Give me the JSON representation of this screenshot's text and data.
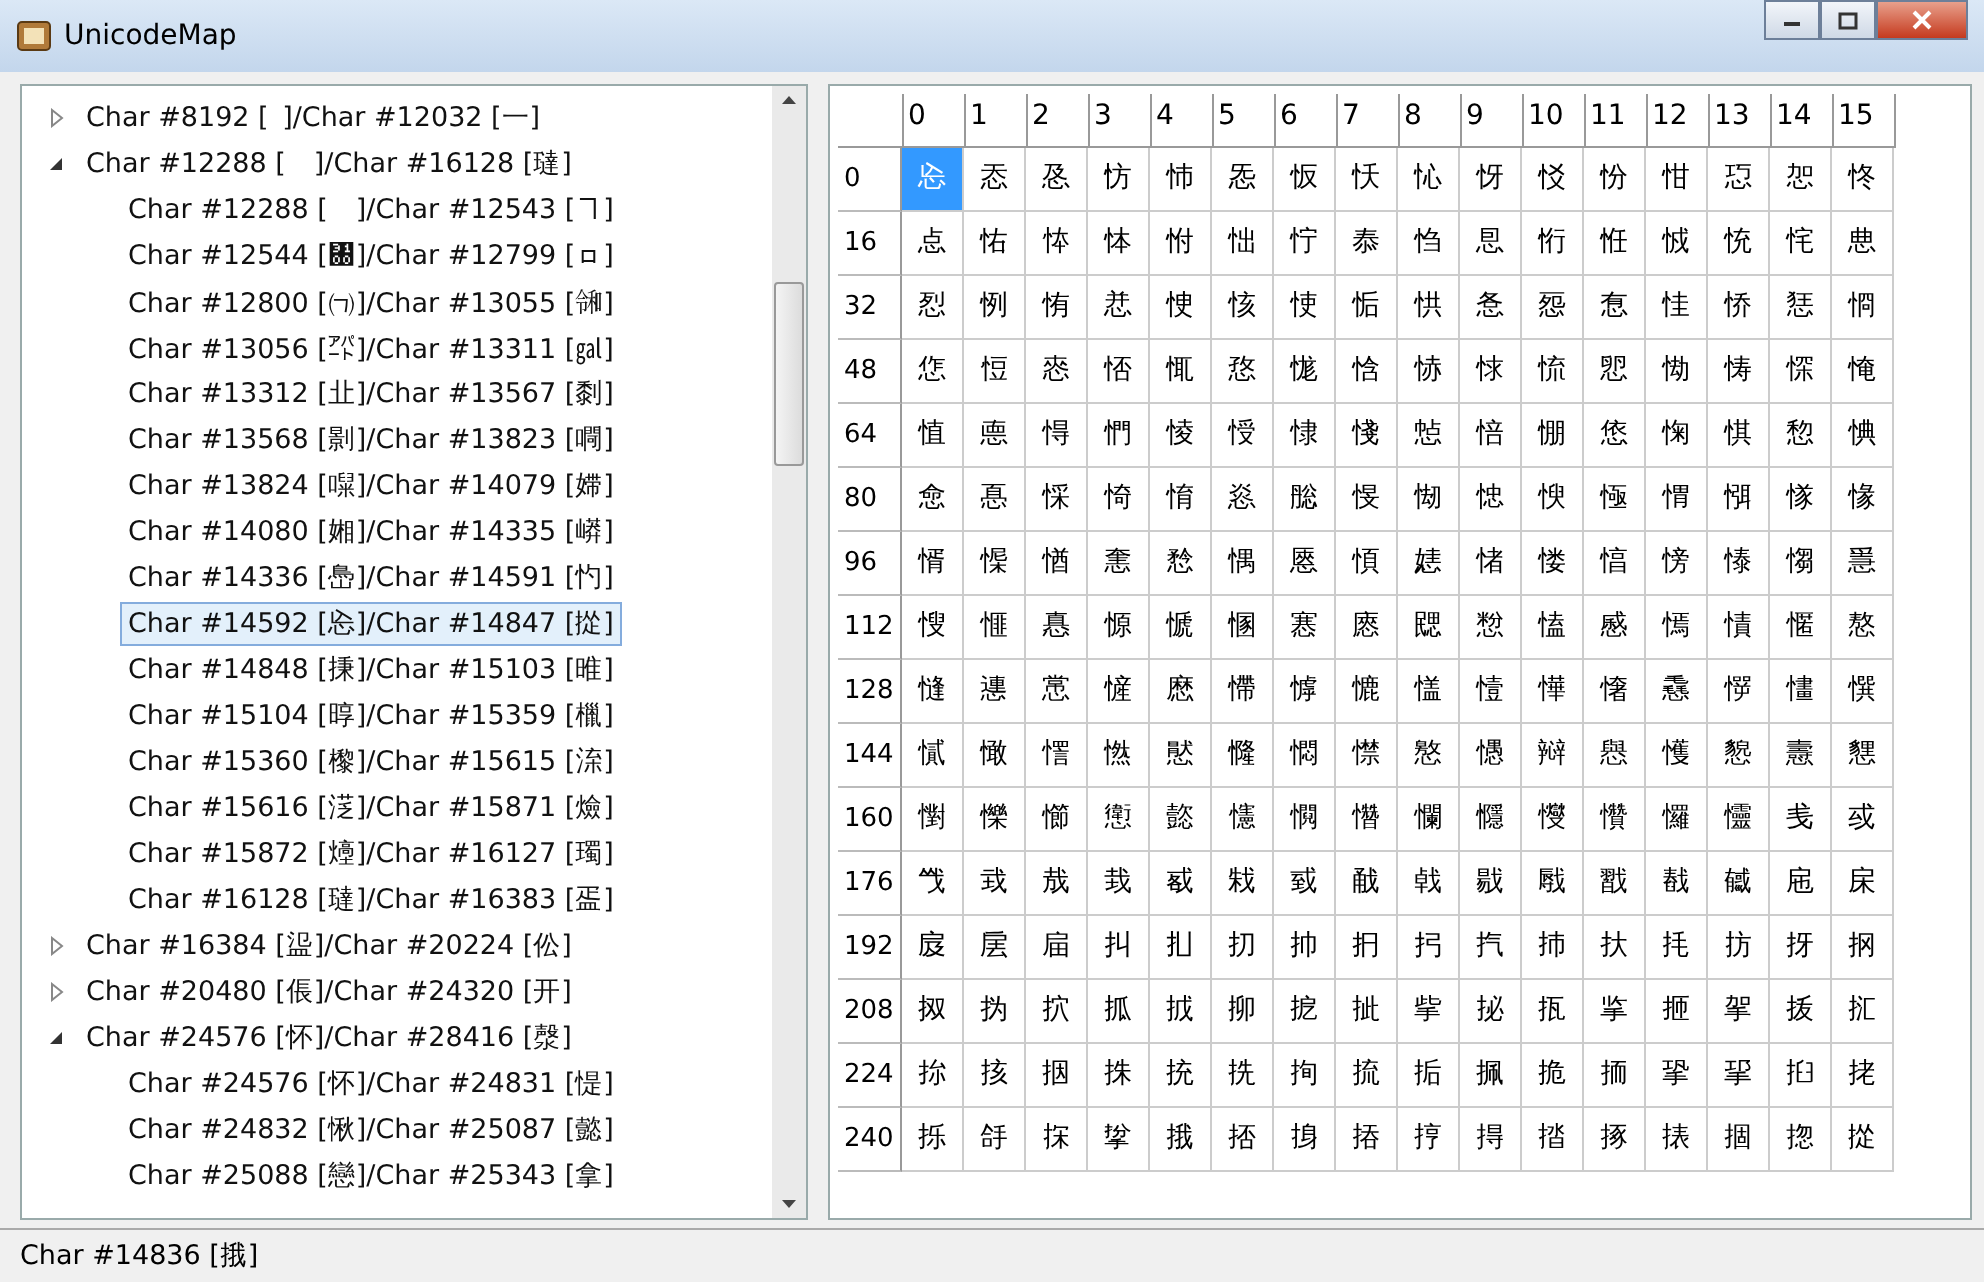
{
  "window": {
    "title": "UnicodeMap"
  },
  "tree": [
    {
      "label": "Char #8192 [ ]/Char #12032 [⼀]",
      "expanded": false,
      "selected": false
    },
    {
      "label": "Char #12288 [　]/Char #16128 [㼀]",
      "expanded": true,
      "selected": false,
      "children": [
        {
          "label": "Char #12288 [　]/Char #12543 [ヿ]",
          "selected": false
        },
        {
          "label": "Char #12544 [㄀]/Char #12799 [ㇿ]",
          "selected": false
        },
        {
          "label": "Char #12800 [㈀]/Char #13055 [㋿]",
          "selected": false
        },
        {
          "label": "Char #13056 [㌀]/Char #13311 [㏿]",
          "selected": false
        },
        {
          "label": "Char #13312 [㐀]/Char #13567 [㓿]",
          "selected": false
        },
        {
          "label": "Char #13568 [㔀]/Char #13823 [㗿]",
          "selected": false
        },
        {
          "label": "Char #13824 [㘀]/Char #14079 [㛿]",
          "selected": false
        },
        {
          "label": "Char #14080 [㜀]/Char #14335 [㟿]",
          "selected": false
        },
        {
          "label": "Char #14336 [㠀]/Char #14591 [㣿]",
          "selected": false
        },
        {
          "label": "Char #14592 [㤀]/Char #14847 [㧿]",
          "selected": true
        },
        {
          "label": "Char #14848 [㨀]/Char #15103 [㫿]",
          "selected": false
        },
        {
          "label": "Char #15104 [㬀]/Char #15359 [㯿]",
          "selected": false
        },
        {
          "label": "Char #15360 [㰀]/Char #15615 [㳿]",
          "selected": false
        },
        {
          "label": "Char #15616 [㴀]/Char #15871 [㷿]",
          "selected": false
        },
        {
          "label": "Char #15872 [㸀]/Char #16127 [㻿]",
          "selected": false
        },
        {
          "label": "Char #16128 [㼀]/Char #16383 [㿿]",
          "selected": false
        }
      ]
    },
    {
      "label": "Char #16384 [䀀]/Char #20224 [伀]",
      "expanded": false,
      "selected": false
    },
    {
      "label": "Char #20480 [倀]/Char #24320 [开]",
      "expanded": false,
      "selected": false
    },
    {
      "label": "Char #24576 [怀]/Char #28416 [漀]",
      "expanded": true,
      "selected": false,
      "children": [
        {
          "label": "Char #24576 [怀]/Char #24831 [惿]",
          "selected": false
        },
        {
          "label": "Char #24832 [愀]/Char #25087 [懿]",
          "selected": false
        },
        {
          "label": "Char #25088 [戀]/Char #25343 [拿]",
          "selected": false
        }
      ]
    }
  ],
  "grid": {
    "columns": [
      "0",
      "1",
      "2",
      "3",
      "4",
      "5",
      "6",
      "7",
      "8",
      "9",
      "10",
      "11",
      "12",
      "13",
      "14",
      "15"
    ],
    "rows": [
      {
        "label": "0",
        "cells": [
          {
            "char": "㤀",
            "selected": true
          },
          {
            "char": "㤁",
            "selected": false
          },
          {
            "char": "㤂",
            "selected": false
          },
          {
            "char": "㤃",
            "selected": false
          },
          {
            "char": "㤄",
            "selected": false
          },
          {
            "char": "㤅",
            "selected": false
          },
          {
            "char": "㤆",
            "selected": false
          },
          {
            "char": "㤇",
            "selected": false
          },
          {
            "char": "㤈",
            "selected": false
          },
          {
            "char": "㤉",
            "selected": false
          },
          {
            "char": "㤊",
            "selected": false
          },
          {
            "char": "㤋",
            "selected": false
          },
          {
            "char": "㤌",
            "selected": false
          },
          {
            "char": "㤍",
            "selected": false
          },
          {
            "char": "㤎",
            "selected": false
          },
          {
            "char": "㤏",
            "selected": false
          }
        ]
      },
      {
        "label": "16",
        "cells": [
          {
            "char": "㤐",
            "selected": false
          },
          {
            "char": "㤑",
            "selected": false
          },
          {
            "char": "㤒",
            "selected": false
          },
          {
            "char": "㤓",
            "selected": false
          },
          {
            "char": "㤔",
            "selected": false
          },
          {
            "char": "㤕",
            "selected": false
          },
          {
            "char": "㤖",
            "selected": false
          },
          {
            "char": "㤗",
            "selected": false
          },
          {
            "char": "㤘",
            "selected": false
          },
          {
            "char": "㤙",
            "selected": false
          },
          {
            "char": "㤚",
            "selected": false
          },
          {
            "char": "㤛",
            "selected": false
          },
          {
            "char": "㤜",
            "selected": false
          },
          {
            "char": "㤝",
            "selected": false
          },
          {
            "char": "㤞",
            "selected": false
          },
          {
            "char": "㤟",
            "selected": false
          }
        ]
      },
      {
        "label": "32",
        "cells": [
          {
            "char": "㤠",
            "selected": false
          },
          {
            "char": "㤡",
            "selected": false
          },
          {
            "char": "㤢",
            "selected": false
          },
          {
            "char": "㤣",
            "selected": false
          },
          {
            "char": "㤤",
            "selected": false
          },
          {
            "char": "㤥",
            "selected": false
          },
          {
            "char": "㤦",
            "selected": false
          },
          {
            "char": "㤧",
            "selected": false
          },
          {
            "char": "㤨",
            "selected": false
          },
          {
            "char": "㤩",
            "selected": false
          },
          {
            "char": "㤪",
            "selected": false
          },
          {
            "char": "㤫",
            "selected": false
          },
          {
            "char": "㤬",
            "selected": false
          },
          {
            "char": "㤭",
            "selected": false
          },
          {
            "char": "㤮",
            "selected": false
          },
          {
            "char": "㤯",
            "selected": false
          }
        ]
      },
      {
        "label": "48",
        "cells": [
          {
            "char": "㤰",
            "selected": false
          },
          {
            "char": "㤱",
            "selected": false
          },
          {
            "char": "㤲",
            "selected": false
          },
          {
            "char": "㤳",
            "selected": false
          },
          {
            "char": "㤴",
            "selected": false
          },
          {
            "char": "㤵",
            "selected": false
          },
          {
            "char": "㤶",
            "selected": false
          },
          {
            "char": "㤷",
            "selected": false
          },
          {
            "char": "㤸",
            "selected": false
          },
          {
            "char": "㤹",
            "selected": false
          },
          {
            "char": "㤺",
            "selected": false
          },
          {
            "char": "㤻",
            "selected": false
          },
          {
            "char": "㤼",
            "selected": false
          },
          {
            "char": "㤽",
            "selected": false
          },
          {
            "char": "㤾",
            "selected": false
          },
          {
            "char": "㤿",
            "selected": false
          }
        ]
      },
      {
        "label": "64",
        "cells": [
          {
            "char": "㥀",
            "selected": false
          },
          {
            "char": "㥁",
            "selected": false
          },
          {
            "char": "㥂",
            "selected": false
          },
          {
            "char": "㥃",
            "selected": false
          },
          {
            "char": "㥄",
            "selected": false
          },
          {
            "char": "㥅",
            "selected": false
          },
          {
            "char": "㥆",
            "selected": false
          },
          {
            "char": "㥇",
            "selected": false
          },
          {
            "char": "㥈",
            "selected": false
          },
          {
            "char": "㥉",
            "selected": false
          },
          {
            "char": "㥊",
            "selected": false
          },
          {
            "char": "㥋",
            "selected": false
          },
          {
            "char": "㥌",
            "selected": false
          },
          {
            "char": "㥍",
            "selected": false
          },
          {
            "char": "㥎",
            "selected": false
          },
          {
            "char": "㥏",
            "selected": false
          }
        ]
      },
      {
        "label": "80",
        "cells": [
          {
            "char": "㥐",
            "selected": false
          },
          {
            "char": "㥑",
            "selected": false
          },
          {
            "char": "㥒",
            "selected": false
          },
          {
            "char": "㥓",
            "selected": false
          },
          {
            "char": "㥔",
            "selected": false
          },
          {
            "char": "㥕",
            "selected": false
          },
          {
            "char": "㥖",
            "selected": false
          },
          {
            "char": "㥗",
            "selected": false
          },
          {
            "char": "㥘",
            "selected": false
          },
          {
            "char": "㥙",
            "selected": false
          },
          {
            "char": "㥚",
            "selected": false
          },
          {
            "char": "㥛",
            "selected": false
          },
          {
            "char": "㥜",
            "selected": false
          },
          {
            "char": "㥝",
            "selected": false
          },
          {
            "char": "㥞",
            "selected": false
          },
          {
            "char": "㥟",
            "selected": false
          }
        ]
      },
      {
        "label": "96",
        "cells": [
          {
            "char": "㥠",
            "selected": false
          },
          {
            "char": "㥡",
            "selected": false
          },
          {
            "char": "㥢",
            "selected": false
          },
          {
            "char": "㥣",
            "selected": false
          },
          {
            "char": "㥤",
            "selected": false
          },
          {
            "char": "㥥",
            "selected": false
          },
          {
            "char": "㥦",
            "selected": false
          },
          {
            "char": "㥧",
            "selected": false
          },
          {
            "char": "㥨",
            "selected": false
          },
          {
            "char": "㥩",
            "selected": false
          },
          {
            "char": "㥪",
            "selected": false
          },
          {
            "char": "㥫",
            "selected": false
          },
          {
            "char": "㥬",
            "selected": false
          },
          {
            "char": "㥭",
            "selected": false
          },
          {
            "char": "㥮",
            "selected": false
          },
          {
            "char": "㥯",
            "selected": false
          }
        ]
      },
      {
        "label": "112",
        "cells": [
          {
            "char": "㥰",
            "selected": false
          },
          {
            "char": "㥱",
            "selected": false
          },
          {
            "char": "㥲",
            "selected": false
          },
          {
            "char": "㥳",
            "selected": false
          },
          {
            "char": "㥴",
            "selected": false
          },
          {
            "char": "㥵",
            "selected": false
          },
          {
            "char": "㥶",
            "selected": false
          },
          {
            "char": "㥷",
            "selected": false
          },
          {
            "char": "㥸",
            "selected": false
          },
          {
            "char": "㥹",
            "selected": false
          },
          {
            "char": "㥺",
            "selected": false
          },
          {
            "char": "㥻",
            "selected": false
          },
          {
            "char": "㥼",
            "selected": false
          },
          {
            "char": "㥽",
            "selected": false
          },
          {
            "char": "㥾",
            "selected": false
          },
          {
            "char": "㥿",
            "selected": false
          }
        ]
      },
      {
        "label": "128",
        "cells": [
          {
            "char": "㦀",
            "selected": false
          },
          {
            "char": "㦁",
            "selected": false
          },
          {
            "char": "㦂",
            "selected": false
          },
          {
            "char": "㦃",
            "selected": false
          },
          {
            "char": "㦄",
            "selected": false
          },
          {
            "char": "㦅",
            "selected": false
          },
          {
            "char": "㦆",
            "selected": false
          },
          {
            "char": "㦇",
            "selected": false
          },
          {
            "char": "㦈",
            "selected": false
          },
          {
            "char": "㦉",
            "selected": false
          },
          {
            "char": "㦊",
            "selected": false
          },
          {
            "char": "㦋",
            "selected": false
          },
          {
            "char": "㦌",
            "selected": false
          },
          {
            "char": "㦍",
            "selected": false
          },
          {
            "char": "㦎",
            "selected": false
          },
          {
            "char": "㦏",
            "selected": false
          }
        ]
      },
      {
        "label": "144",
        "cells": [
          {
            "char": "㦐",
            "selected": false
          },
          {
            "char": "㦑",
            "selected": false
          },
          {
            "char": "㦒",
            "selected": false
          },
          {
            "char": "㦓",
            "selected": false
          },
          {
            "char": "㦔",
            "selected": false
          },
          {
            "char": "㦕",
            "selected": false
          },
          {
            "char": "㦖",
            "selected": false
          },
          {
            "char": "㦗",
            "selected": false
          },
          {
            "char": "㦘",
            "selected": false
          },
          {
            "char": "㦙",
            "selected": false
          },
          {
            "char": "㦚",
            "selected": false
          },
          {
            "char": "㦛",
            "selected": false
          },
          {
            "char": "㦜",
            "selected": false
          },
          {
            "char": "㦝",
            "selected": false
          },
          {
            "char": "㦞",
            "selected": false
          },
          {
            "char": "㦟",
            "selected": false
          }
        ]
      },
      {
        "label": "160",
        "cells": [
          {
            "char": "㦠",
            "selected": false
          },
          {
            "char": "㦡",
            "selected": false
          },
          {
            "char": "㦢",
            "selected": false
          },
          {
            "char": "㦣",
            "selected": false
          },
          {
            "char": "㦤",
            "selected": false
          },
          {
            "char": "㦥",
            "selected": false
          },
          {
            "char": "㦦",
            "selected": false
          },
          {
            "char": "㦧",
            "selected": false
          },
          {
            "char": "㦨",
            "selected": false
          },
          {
            "char": "㦩",
            "selected": false
          },
          {
            "char": "㦪",
            "selected": false
          },
          {
            "char": "㦫",
            "selected": false
          },
          {
            "char": "㦬",
            "selected": false
          },
          {
            "char": "㦭",
            "selected": false
          },
          {
            "char": "㦮",
            "selected": false
          },
          {
            "char": "㦯",
            "selected": false
          }
        ]
      },
      {
        "label": "176",
        "cells": [
          {
            "char": "㦰",
            "selected": false
          },
          {
            "char": "㦱",
            "selected": false
          },
          {
            "char": "㦲",
            "selected": false
          },
          {
            "char": "㦳",
            "selected": false
          },
          {
            "char": "㦴",
            "selected": false
          },
          {
            "char": "㦵",
            "selected": false
          },
          {
            "char": "㦶",
            "selected": false
          },
          {
            "char": "㦷",
            "selected": false
          },
          {
            "char": "㦸",
            "selected": false
          },
          {
            "char": "㦹",
            "selected": false
          },
          {
            "char": "㦺",
            "selected": false
          },
          {
            "char": "㦻",
            "selected": false
          },
          {
            "char": "㦼",
            "selected": false
          },
          {
            "char": "㦽",
            "selected": false
          },
          {
            "char": "㦾",
            "selected": false
          },
          {
            "char": "㦿",
            "selected": false
          }
        ]
      },
      {
        "label": "192",
        "cells": [
          {
            "char": "㧀",
            "selected": false
          },
          {
            "char": "㧁",
            "selected": false
          },
          {
            "char": "㧂",
            "selected": false
          },
          {
            "char": "㧃",
            "selected": false
          },
          {
            "char": "㧄",
            "selected": false
          },
          {
            "char": "㧅",
            "selected": false
          },
          {
            "char": "㧆",
            "selected": false
          },
          {
            "char": "㧇",
            "selected": false
          },
          {
            "char": "㧈",
            "selected": false
          },
          {
            "char": "㧉",
            "selected": false
          },
          {
            "char": "㧊",
            "selected": false
          },
          {
            "char": "㧋",
            "selected": false
          },
          {
            "char": "㧌",
            "selected": false
          },
          {
            "char": "㧍",
            "selected": false
          },
          {
            "char": "㧎",
            "selected": false
          },
          {
            "char": "㧏",
            "selected": false
          }
        ]
      },
      {
        "label": "208",
        "cells": [
          {
            "char": "㧐",
            "selected": false
          },
          {
            "char": "㧑",
            "selected": false
          },
          {
            "char": "㧒",
            "selected": false
          },
          {
            "char": "㧓",
            "selected": false
          },
          {
            "char": "㧔",
            "selected": false
          },
          {
            "char": "㧕",
            "selected": false
          },
          {
            "char": "㧖",
            "selected": false
          },
          {
            "char": "㧗",
            "selected": false
          },
          {
            "char": "㧘",
            "selected": false
          },
          {
            "char": "㧙",
            "selected": false
          },
          {
            "char": "㧚",
            "selected": false
          },
          {
            "char": "㧛",
            "selected": false
          },
          {
            "char": "㧜",
            "selected": false
          },
          {
            "char": "㧝",
            "selected": false
          },
          {
            "char": "㧞",
            "selected": false
          },
          {
            "char": "㧟",
            "selected": false
          }
        ]
      },
      {
        "label": "224",
        "cells": [
          {
            "char": "㧠",
            "selected": false
          },
          {
            "char": "㧡",
            "selected": false
          },
          {
            "char": "㧢",
            "selected": false
          },
          {
            "char": "㧣",
            "selected": false
          },
          {
            "char": "㧤",
            "selected": false
          },
          {
            "char": "㧥",
            "selected": false
          },
          {
            "char": "㧦",
            "selected": false
          },
          {
            "char": "㧧",
            "selected": false
          },
          {
            "char": "㧨",
            "selected": false
          },
          {
            "char": "㧩",
            "selected": false
          },
          {
            "char": "㧪",
            "selected": false
          },
          {
            "char": "㧫",
            "selected": false
          },
          {
            "char": "㧬",
            "selected": false
          },
          {
            "char": "㧭",
            "selected": false
          },
          {
            "char": "㧮",
            "selected": false
          },
          {
            "char": "㧯",
            "selected": false
          }
        ]
      },
      {
        "label": "240",
        "cells": [
          {
            "char": "㧰",
            "selected": false
          },
          {
            "char": "㧱",
            "selected": false
          },
          {
            "char": "㧲",
            "selected": false
          },
          {
            "char": "㧳",
            "selected": false
          },
          {
            "char": "㧴",
            "selected": false
          },
          {
            "char": "㧵",
            "selected": false
          },
          {
            "char": "㧶",
            "selected": false
          },
          {
            "char": "㧷",
            "selected": false
          },
          {
            "char": "㧸",
            "selected": false
          },
          {
            "char": "㧹",
            "selected": false
          },
          {
            "char": "㧺",
            "selected": false
          },
          {
            "char": "㧻",
            "selected": false
          },
          {
            "char": "㧼",
            "selected": false
          },
          {
            "char": "㧽",
            "selected": false
          },
          {
            "char": "㧾",
            "selected": false
          },
          {
            "char": "㧿",
            "selected": false
          }
        ]
      }
    ]
  },
  "status_bar": {
    "text": "Char #14836 [㧴]"
  }
}
